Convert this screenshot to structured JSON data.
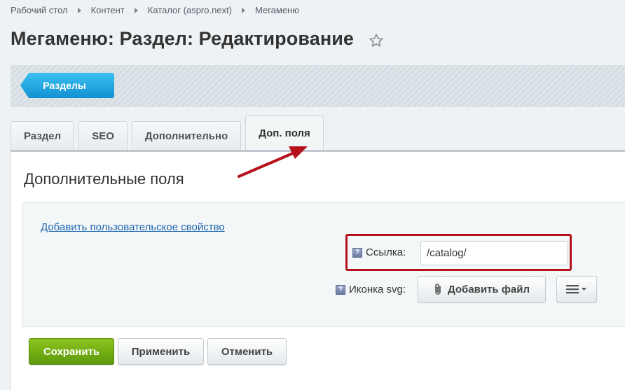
{
  "breadcrumb": [
    "Рабочий стол",
    "Контент",
    "Каталог (aspro.next)",
    "Мегаменю"
  ],
  "page_title": "Мегаменю: Раздел: Редактирование",
  "toolbar": {
    "sections_label": "Разделы"
  },
  "tabs": [
    {
      "label": "Раздел",
      "active": false
    },
    {
      "label": "SEO",
      "active": false
    },
    {
      "label": "Дополнительно",
      "active": false
    },
    {
      "label": "Доп. поля",
      "active": true
    }
  ],
  "section_title": "Дополнительные поля",
  "add_property_link": "Добавить пользовательское свойство",
  "fields": {
    "link": {
      "label": "Ссылка:",
      "value": "/catalog/"
    },
    "icon_svg": {
      "label": "Иконка svg:",
      "button_label": "Добавить файл"
    }
  },
  "help_icon_text": "?",
  "buttons": {
    "save": "Сохранить",
    "apply": "Применить",
    "cancel": "Отменить"
  },
  "colors": {
    "accent_blue": "#1fa3e0",
    "save_green": "#6fae14",
    "highlight_red": "#b5121b",
    "link_blue": "#2067b0"
  }
}
